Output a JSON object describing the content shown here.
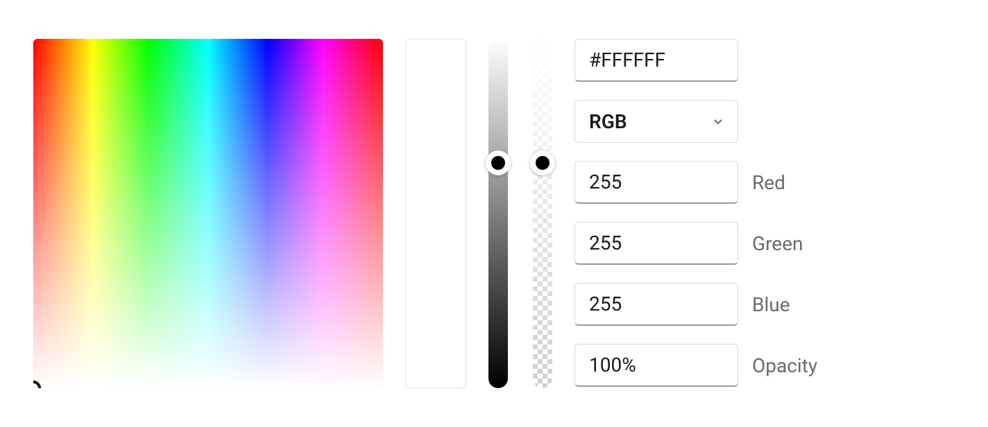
{
  "hex": {
    "value": "#FFFFFF"
  },
  "mode": {
    "selected": "RGB"
  },
  "channels": {
    "red": {
      "value": "255",
      "label": "Red"
    },
    "green": {
      "value": "255",
      "label": "Green"
    },
    "blue": {
      "value": "255",
      "label": "Blue"
    }
  },
  "opacity": {
    "value": "100%",
    "label": "Opacity"
  }
}
